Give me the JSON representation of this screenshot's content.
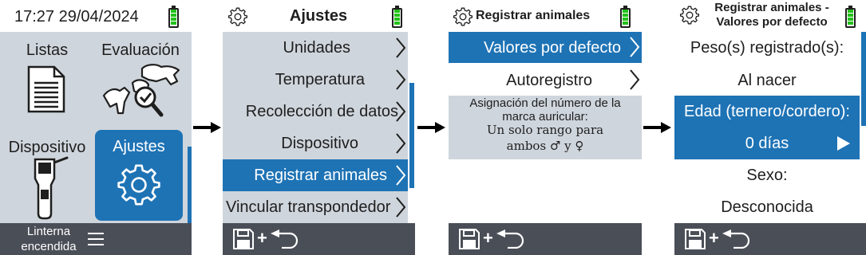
{
  "screen1": {
    "time": "17:27 29/04/2024",
    "tiles": {
      "lists": "Listas",
      "evaluation": "Evaluación",
      "device": "Dispositivo",
      "settings": "Ajustes"
    },
    "footer": {
      "line1": "Linterna",
      "line2": "encendida"
    }
  },
  "screen2": {
    "title": "Ajustes",
    "items": [
      {
        "label": "Unidades"
      },
      {
        "label": "Temperatura"
      },
      {
        "label": "Recolección de datos"
      },
      {
        "label": "Dispositivo"
      },
      {
        "label": "Registrar animales"
      },
      {
        "label": "Vincular transpondedor"
      }
    ]
  },
  "screen3": {
    "title": "Registrar animales",
    "items": [
      {
        "label": "Valores por defecto"
      },
      {
        "label": "Autoregistro"
      }
    ],
    "info": {
      "line1": "Asignación del número de la",
      "line2": "marca auricular:",
      "line3": "Un solo rango para",
      "line4": "ambos ♂ y ♀"
    }
  },
  "screen4": {
    "title_line1": "Registrar animales -",
    "title_line2": "Valores por defecto",
    "rows": [
      {
        "label": "Peso(s) registrado(s):"
      },
      {
        "label": "Al nacer"
      },
      {
        "label": "Edad (ternero/cordero):"
      },
      {
        "label": "0 días"
      },
      {
        "label": "Sexo:"
      },
      {
        "label": "Desconocida"
      }
    ]
  },
  "colors": {
    "accent": "#1e73b5",
    "list_background": "#cfd5dc",
    "bottom_bar": "#4a4e57",
    "battery": "#22c018"
  },
  "icons": [
    "battery-icon",
    "gear-icon",
    "document-icon",
    "cattle-inspect-icon",
    "handheld-device-icon",
    "menu-icon",
    "save-icon",
    "back-arrow-icon",
    "chevron-right-icon",
    "play-triangle-icon",
    "arrow-right-icon"
  ]
}
